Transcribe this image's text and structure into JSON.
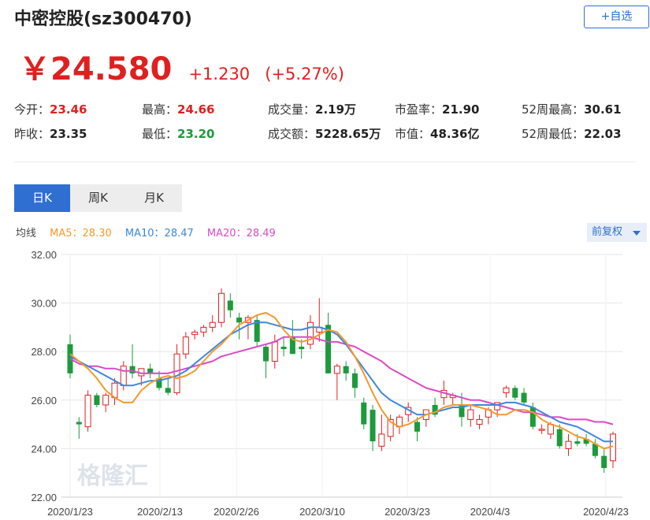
{
  "header": {
    "title": "中密控股(sz300470)",
    "add_button": "+自选"
  },
  "quote": {
    "price": "￥24.580",
    "change": "+1.230",
    "change_pct": "(+5.27%)"
  },
  "stats": [
    {
      "label": "今开：",
      "value": "23.46",
      "color": "red"
    },
    {
      "label": "最高：",
      "value": "24.66",
      "color": "red"
    },
    {
      "label": "成交量：",
      "value": "2.19万",
      "color": "dark"
    },
    {
      "label": "市盈率：",
      "value": "21.90",
      "color": "dark"
    },
    {
      "label": "52周最高：",
      "value": "30.61",
      "color": "dark"
    },
    {
      "label": "昨收：",
      "value": "23.35",
      "color": "dark"
    },
    {
      "label": "最低：",
      "value": "23.20",
      "color": "green"
    },
    {
      "label": "成交额：",
      "value": "5228.65万",
      "color": "dark"
    },
    {
      "label": "市值：",
      "value": "48.36亿",
      "color": "dark"
    },
    {
      "label": "52周最低：",
      "value": "22.03",
      "color": "dark"
    }
  ],
  "tabs": [
    "日K",
    "周K",
    "月K"
  ],
  "ma_legend": {
    "label": "均线",
    "ma5": "MA5：28.30",
    "ma10": "MA10：28.47",
    "ma20": "MA20：28.49"
  },
  "adjust_button": "前复权",
  "colors": {
    "up": "#e02020",
    "down": "#1c9a3c",
    "ma5": "#f29a2e",
    "ma10": "#3f86dd",
    "ma20": "#d94bc4",
    "accent": "#2f6fd1"
  },
  "watermark": "格隆汇",
  "chart_data": {
    "type": "candlestick",
    "ylim": [
      22,
      32
    ],
    "yticks": [
      "32.00",
      "30.00",
      "28.00",
      "26.00",
      "24.00",
      "22.00"
    ],
    "xticks": [
      "2020/1/23",
      "2020/2/13",
      "2020/2/26",
      "2020/3/10",
      "2020/3/23",
      "2020/4/3",
      "2020/4/23"
    ],
    "grid": true,
    "candles": [
      {
        "o": 28.3,
        "h": 28.7,
        "l": 26.9,
        "c": 27.1
      },
      {
        "o": 25.1,
        "h": 25.3,
        "l": 24.4,
        "c": 25.0
      },
      {
        "o": 24.9,
        "h": 26.4,
        "l": 24.7,
        "c": 26.2
      },
      {
        "o": 26.2,
        "h": 26.3,
        "l": 25.7,
        "c": 25.8
      },
      {
        "o": 25.8,
        "h": 26.3,
        "l": 25.5,
        "c": 26.2
      },
      {
        "o": 26.1,
        "h": 26.9,
        "l": 25.8,
        "c": 26.7
      },
      {
        "o": 26.6,
        "h": 27.6,
        "l": 26.4,
        "c": 27.4
      },
      {
        "o": 27.4,
        "h": 28.3,
        "l": 26.9,
        "c": 27.1
      },
      {
        "o": 27.0,
        "h": 27.3,
        "l": 26.6,
        "c": 27.3
      },
      {
        "o": 27.3,
        "h": 27.5,
        "l": 26.9,
        "c": 27.1
      },
      {
        "o": 26.9,
        "h": 27.2,
        "l": 26.4,
        "c": 26.5
      },
      {
        "o": 26.5,
        "h": 26.9,
        "l": 26.2,
        "c": 26.3
      },
      {
        "o": 26.3,
        "h": 28.3,
        "l": 26.2,
        "c": 27.9
      },
      {
        "o": 27.9,
        "h": 28.8,
        "l": 27.7,
        "c": 28.6
      },
      {
        "o": 28.7,
        "h": 28.9,
        "l": 28.5,
        "c": 28.8
      },
      {
        "o": 28.8,
        "h": 29.1,
        "l": 28.6,
        "c": 29.0
      },
      {
        "o": 29.0,
        "h": 29.5,
        "l": 28.8,
        "c": 29.2
      },
      {
        "o": 29.2,
        "h": 30.6,
        "l": 29.0,
        "c": 30.4
      },
      {
        "o": 30.1,
        "h": 30.4,
        "l": 29.4,
        "c": 29.7
      },
      {
        "o": 29.4,
        "h": 29.6,
        "l": 28.5,
        "c": 29.2
      },
      {
        "o": 29.2,
        "h": 29.5,
        "l": 28.5,
        "c": 29.4
      },
      {
        "o": 29.3,
        "h": 29.5,
        "l": 28.2,
        "c": 28.4
      },
      {
        "o": 28.2,
        "h": 28.3,
        "l": 26.9,
        "c": 27.6
      },
      {
        "o": 27.6,
        "h": 28.7,
        "l": 27.3,
        "c": 28.4
      },
      {
        "o": 28.2,
        "h": 28.6,
        "l": 27.8,
        "c": 28.1
      },
      {
        "o": 28.6,
        "h": 29.3,
        "l": 27.9,
        "c": 27.9
      },
      {
        "o": 28.2,
        "h": 28.5,
        "l": 27.7,
        "c": 28.1
      },
      {
        "o": 28.3,
        "h": 29.5,
        "l": 28.1,
        "c": 29.2
      },
      {
        "o": 28.8,
        "h": 30.2,
        "l": 28.4,
        "c": 29.0
      },
      {
        "o": 29.1,
        "h": 29.6,
        "l": 28.5,
        "c": 27.1
      },
      {
        "o": 27.1,
        "h": 27.5,
        "l": 26.0,
        "c": 27.4
      },
      {
        "o": 27.4,
        "h": 27.6,
        "l": 26.8,
        "c": 27.1
      },
      {
        "o": 27.1,
        "h": 27.3,
        "l": 26.1,
        "c": 26.5
      },
      {
        "o": 25.9,
        "h": 26.1,
        "l": 24.8,
        "c": 25.0
      },
      {
        "o": 25.6,
        "h": 25.8,
        "l": 23.9,
        "c": 24.3
      },
      {
        "o": 24.1,
        "h": 25.4,
        "l": 23.9,
        "c": 24.6
      },
      {
        "o": 24.5,
        "h": 25.4,
        "l": 24.3,
        "c": 25.2
      },
      {
        "o": 24.9,
        "h": 25.4,
        "l": 24.6,
        "c": 25.3
      },
      {
        "o": 25.4,
        "h": 25.9,
        "l": 25.1,
        "c": 25.7
      },
      {
        "o": 25.1,
        "h": 25.3,
        "l": 24.3,
        "c": 24.7
      },
      {
        "o": 25.2,
        "h": 25.6,
        "l": 24.9,
        "c": 25.6
      },
      {
        "o": 25.8,
        "h": 26.1,
        "l": 25.3,
        "c": 25.4
      },
      {
        "o": 26.1,
        "h": 26.8,
        "l": 25.8,
        "c": 26.4
      },
      {
        "o": 26.1,
        "h": 26.3,
        "l": 25.8,
        "c": 26.2
      },
      {
        "o": 25.8,
        "h": 26.3,
        "l": 24.9,
        "c": 25.3
      },
      {
        "o": 25.2,
        "h": 25.8,
        "l": 24.9,
        "c": 25.6
      },
      {
        "o": 25.0,
        "h": 25.4,
        "l": 24.8,
        "c": 25.2
      },
      {
        "o": 25.3,
        "h": 25.7,
        "l": 25.0,
        "c": 25.6
      },
      {
        "o": 25.6,
        "h": 25.9,
        "l": 25.3,
        "c": 25.9
      },
      {
        "o": 26.3,
        "h": 26.6,
        "l": 26.1,
        "c": 26.5
      },
      {
        "o": 26.5,
        "h": 26.6,
        "l": 26.0,
        "c": 26.1
      },
      {
        "o": 26.3,
        "h": 26.5,
        "l": 25.8,
        "c": 25.9
      },
      {
        "o": 25.7,
        "h": 25.9,
        "l": 24.8,
        "c": 24.9
      },
      {
        "o": 24.8,
        "h": 25.0,
        "l": 24.6,
        "c": 24.8
      },
      {
        "o": 24.6,
        "h": 25.1,
        "l": 24.4,
        "c": 25.0
      },
      {
        "o": 24.8,
        "h": 25.0,
        "l": 24.0,
        "c": 24.1
      },
      {
        "o": 24.0,
        "h": 24.6,
        "l": 23.7,
        "c": 24.3
      },
      {
        "o": 24.3,
        "h": 24.6,
        "l": 24.1,
        "c": 24.2
      },
      {
        "o": 24.4,
        "h": 24.6,
        "l": 24.1,
        "c": 24.2
      },
      {
        "o": 24.2,
        "h": 24.4,
        "l": 23.6,
        "c": 23.7
      },
      {
        "o": 23.7,
        "h": 24.0,
        "l": 23.0,
        "c": 23.2
      },
      {
        "o": 23.5,
        "h": 24.7,
        "l": 23.2,
        "c": 24.6
      }
    ],
    "ma5": [
      27.9,
      27.6,
      27.3,
      26.9,
      26.4,
      26.1,
      25.9,
      25.9,
      26.4,
      26.7,
      26.9,
      27.0,
      26.9,
      27.0,
      27.2,
      27.6,
      28.0,
      28.3,
      28.7,
      29.1,
      29.3,
      29.5,
      29.6,
      29.4,
      28.9,
      28.5,
      28.4,
      28.5,
      28.7,
      28.9,
      28.8,
      28.4,
      27.8,
      27.1,
      26.3,
      25.6,
      25.1,
      24.9,
      25.0,
      25.2,
      25.4,
      25.5,
      25.7,
      25.8,
      25.8,
      25.8,
      25.7,
      25.6,
      25.4,
      25.4,
      25.6,
      25.6,
      25.5,
      25.2,
      25.0,
      24.9,
      24.7,
      24.5,
      24.4,
      24.2,
      24.0,
      24.1
    ],
    "ma10": [
      27.8,
      27.6,
      27.4,
      27.2,
      27.0,
      26.8,
      26.6,
      26.6,
      26.7,
      26.8,
      26.8,
      26.9,
      27.0,
      27.2,
      27.5,
      27.8,
      28.1,
      28.4,
      28.7,
      28.9,
      29.1,
      29.2,
      29.2,
      29.1,
      29.0,
      28.9,
      28.9,
      29.0,
      29.0,
      28.9,
      28.7,
      28.3,
      27.8,
      27.3,
      26.8,
      26.3,
      26.0,
      25.8,
      25.6,
      25.4,
      25.4,
      25.5,
      25.6,
      25.7,
      25.7,
      25.8,
      25.8,
      25.8,
      25.8,
      25.9,
      25.9,
      25.8,
      25.7,
      25.5,
      25.3,
      25.1,
      25.0,
      24.9,
      24.7,
      24.5,
      24.3,
      24.3
    ],
    "ma20": [
      27.7,
      27.5,
      27.4,
      27.4,
      27.3,
      27.3,
      27.2,
      27.2,
      27.1,
      27.1,
      27.1,
      27.1,
      27.2,
      27.3,
      27.4,
      27.5,
      27.6,
      27.8,
      27.9,
      28.0,
      28.1,
      28.2,
      28.3,
      28.4,
      28.6,
      28.6,
      28.6,
      28.6,
      28.5,
      28.4,
      28.4,
      28.3,
      28.2,
      28.0,
      27.8,
      27.6,
      27.3,
      27.1,
      26.9,
      26.7,
      26.5,
      26.4,
      26.3,
      26.2,
      26.1,
      26.0,
      26.0,
      25.9,
      25.8,
      25.7,
      25.6,
      25.5,
      25.5,
      25.4,
      25.3,
      25.3,
      25.2,
      25.2,
      25.2,
      25.1,
      25.1,
      25.0
    ]
  }
}
